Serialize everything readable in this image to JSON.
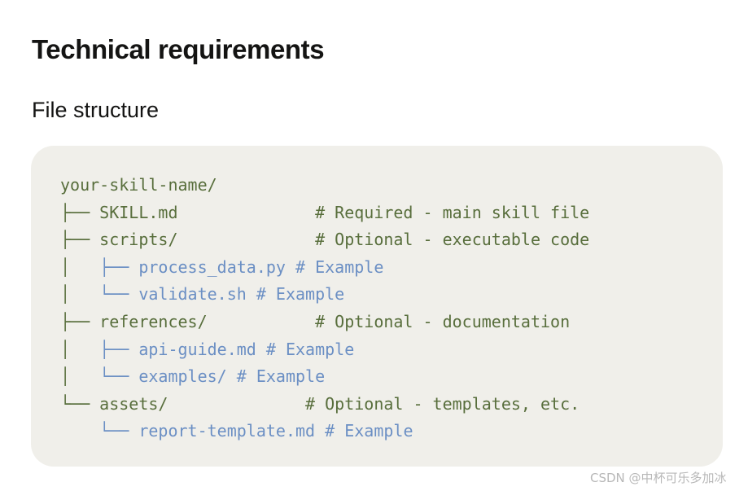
{
  "heading": "Technical requirements",
  "subheading": "File structure",
  "code_lines": [
    {
      "text": "your-skill-name/",
      "style": "main"
    },
    {
      "text": "├── SKILL.md              # Required - main skill file",
      "style": "main"
    },
    {
      "text": "├── scripts/              # Optional - executable code",
      "style": "main"
    },
    {
      "prefix": "│   ",
      "text": "├── process_data.py # Example",
      "style": "sub"
    },
    {
      "prefix": "│   ",
      "text": "└── validate.sh # Example",
      "style": "sub"
    },
    {
      "text": "├── references/           # Optional - documentation",
      "style": "main"
    },
    {
      "prefix": "│   ",
      "text": "├── api-guide.md # Example",
      "style": "sub"
    },
    {
      "prefix": "│   ",
      "text": "└── examples/ # Example",
      "style": "sub"
    },
    {
      "text": "└── assets/              # Optional - templates, etc.",
      "style": "main"
    },
    {
      "prefix": "    ",
      "text": "└── report-template.md # Example",
      "style": "sub"
    }
  ],
  "watermark": "CSDN @中杯可乐多加冰",
  "colors": {
    "background": "#ffffff",
    "code_background": "#f0efea",
    "code_main": "#586e3c",
    "code_sub": "#6b8fc4",
    "heading": "#141413"
  }
}
